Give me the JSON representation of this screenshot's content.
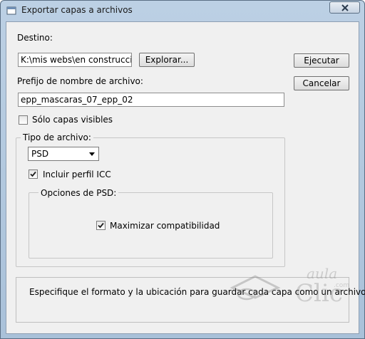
{
  "window": {
    "title": "Exportar capas a archivos"
  },
  "destino": {
    "label": "Destino:",
    "value": "K:\\mis webs\\en construccio",
    "browse_label": "Explorar..."
  },
  "buttons": {
    "run_label": "Ejecutar",
    "cancel_label": "Cancelar"
  },
  "prefix": {
    "label": "Prefijo de nombre de archivo:",
    "value": "epp_mascaras_07_epp_02"
  },
  "visible_only": {
    "label": "Sólo capas visibles",
    "checked": false
  },
  "file_type": {
    "group_label": "Tipo de archivo:",
    "selected": "PSD",
    "icc": {
      "label": "Incluir perfil ICC",
      "checked": true
    },
    "psd_options": {
      "group_label": "Opciones de PSD:",
      "maximize": {
        "label": "Maximizar compatibilidad",
        "checked": true
      }
    }
  },
  "description": "Especifique el formato y la ubicación para guardar cada capa como un archivo.",
  "watermark": {
    "text_top": "aula",
    "text_small": ".com",
    "text_main": "Clic"
  }
}
